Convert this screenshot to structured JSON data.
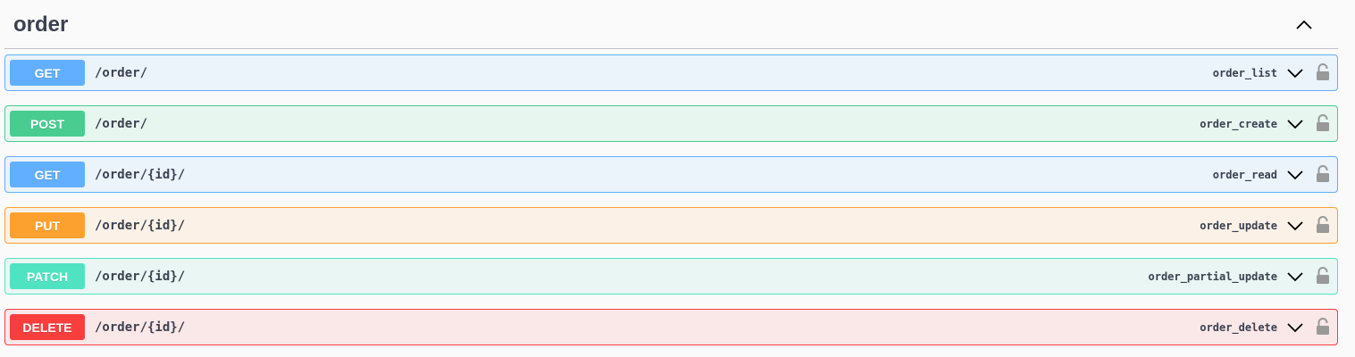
{
  "tag": {
    "title": "order",
    "collapse_icon": "chevron-up-icon"
  },
  "operations": [
    {
      "method": "GET",
      "path": "/order/",
      "operation_id": "order_list",
      "method_color": "#61affe",
      "bg_color": "#ebf3fb",
      "border_color": "#61affe"
    },
    {
      "method": "POST",
      "path": "/order/",
      "operation_id": "order_create",
      "method_color": "#49cc90",
      "bg_color": "#e8f6f0",
      "border_color": "#49cc90"
    },
    {
      "method": "GET",
      "path": "/order/{id}/",
      "operation_id": "order_read",
      "method_color": "#61affe",
      "bg_color": "#ebf3fb",
      "border_color": "#61affe"
    },
    {
      "method": "PUT",
      "path": "/order/{id}/",
      "operation_id": "order_update",
      "method_color": "#fca130",
      "bg_color": "#fbf1e6",
      "border_color": "#fca130"
    },
    {
      "method": "PATCH",
      "path": "/order/{id}/",
      "operation_id": "order_partial_update",
      "method_color": "#50e3c2",
      "bg_color": "#e9f6f3",
      "border_color": "#50e3c2"
    },
    {
      "method": "DELETE",
      "path": "/order/{id}/",
      "operation_id": "order_delete",
      "method_color": "#f93e3e",
      "bg_color": "#fae7e7",
      "border_color": "#f93e3e"
    }
  ],
  "icons": {
    "expand": "chevron-down-icon",
    "auth": "lock-icon"
  }
}
